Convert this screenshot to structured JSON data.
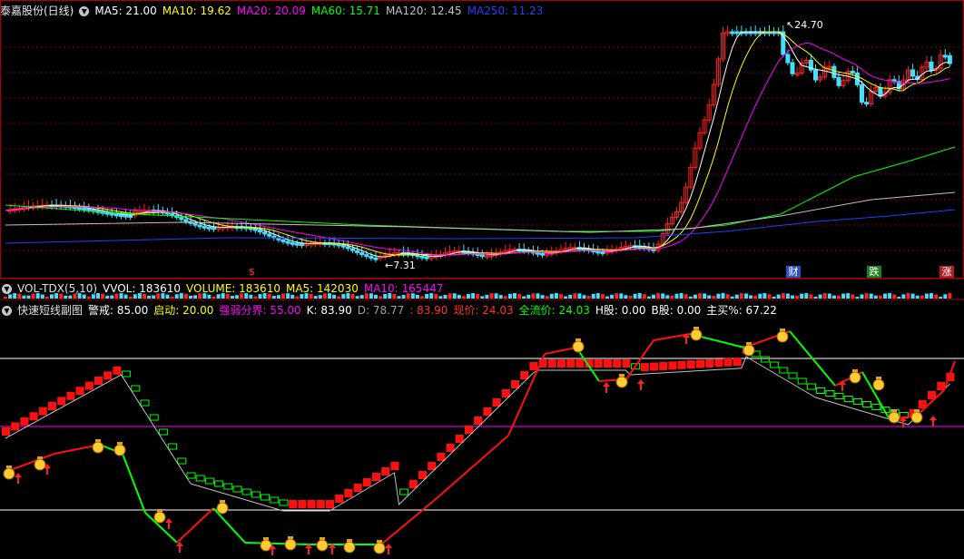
{
  "main": {
    "stock_title": "泰嘉股份(日线)",
    "ma": [
      {
        "label": "MA5: 21.00",
        "color": "#ffffff"
      },
      {
        "label": "MA10: 19.62",
        "color": "#ffff00"
      },
      {
        "label": "MA20: 20.09",
        "color": "#ff00ff"
      },
      {
        "label": "MA60: 15.71",
        "color": "#00ff00"
      },
      {
        "label": "MA120: 12.45",
        "color": "#c0c0c0"
      },
      {
        "label": "MA250: 11.23",
        "color": "#2040ff"
      }
    ],
    "high_label": "24.70",
    "low_label": "7.31",
    "markers": [
      "$",
      "财",
      "跌",
      "涨"
    ]
  },
  "volume": {
    "name": "VOL-TDX(5,10)",
    "items": [
      {
        "label": "VVOL: 183610",
        "color": "#ffffff"
      },
      {
        "label": "VOLUME: 183610",
        "color": "#ffff00"
      },
      {
        "label": "MA5: 142030",
        "color": "#ffff00"
      },
      {
        "label": "MA10: 165447",
        "color": "#ff00ff"
      }
    ]
  },
  "indicator": {
    "name": "快速短线副图",
    "items": [
      {
        "label": "警戒: 85.00",
        "color": "#ffffff"
      },
      {
        "label": "启动: 20.00",
        "color": "#ffff00"
      },
      {
        "label": "强弱分界: 55.00",
        "color": "#ff00ff"
      },
      {
        "label": "K: 83.90",
        "color": "#ffffff"
      },
      {
        "label": "D: 78.77",
        "color": "#a0a0a0"
      },
      {
        "label": ": 83.90",
        "color": "#ff3030"
      },
      {
        "label": "现价: 24.03",
        "color": "#ff3030"
      },
      {
        "label": "全流价: 24.03",
        "color": "#00ff00"
      },
      {
        "label": "H股: 0.00",
        "color": "#ffffff"
      },
      {
        "label": "B股: 0.00",
        "color": "#ffffff"
      },
      {
        "label": "主买%: 67.22",
        "color": "#ffffff"
      }
    ]
  },
  "colors": {
    "up": "#ff2020",
    "down": "#40e0ff",
    "grid": "#8a0000",
    "signal_green": "#00ff00",
    "signal_red": "#ff1010",
    "bag": "#ffcc33"
  }
}
